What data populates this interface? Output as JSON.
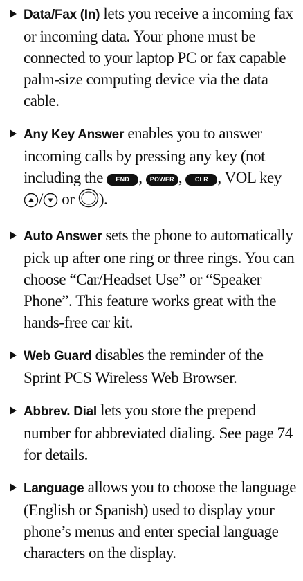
{
  "items": [
    {
      "term": "Data/Fax (In)",
      "text": " lets you receive a incoming fax or incoming data. Your phone must be connected to your laptop PC or fax capable palm-size computing device via the data cable."
    },
    {
      "term": "Any Key Answer",
      "text_a": " enables you to answer incoming calls by pressing any key (not including the ",
      "key_end": "END",
      "sep_1": ", ",
      "key_power": "POWER",
      "sep_2": ", ",
      "key_clr": "CLR",
      "text_b": ", VOL key ",
      "slash": "/",
      "text_c": " or ",
      "text_d": ")."
    },
    {
      "term": "Auto Answer",
      "text": " sets the phone to automatically pick up after one ring or three rings. You can choose “Car/Headset Use” or “Speaker Phone”. This feature works great with the hands-free car kit."
    },
    {
      "term": "Web Guard",
      "text": " disables the reminder of the Sprint PCS Wireless Web Browser."
    },
    {
      "term": "Abbrev. Dial",
      "text": " lets you store the prepend number for abbreviated dialing. See page 74 for details."
    },
    {
      "term": "Language",
      "text": " allows you to choose the language (English or Spanish) used to display your phone’s menus and enter special language characters on the display."
    }
  ],
  "icons": {
    "bullet": "right-arrow-bullet",
    "vol_up": "vol-up-icon",
    "vol_down": "vol-down-icon",
    "nav": "nav-key-icon"
  }
}
